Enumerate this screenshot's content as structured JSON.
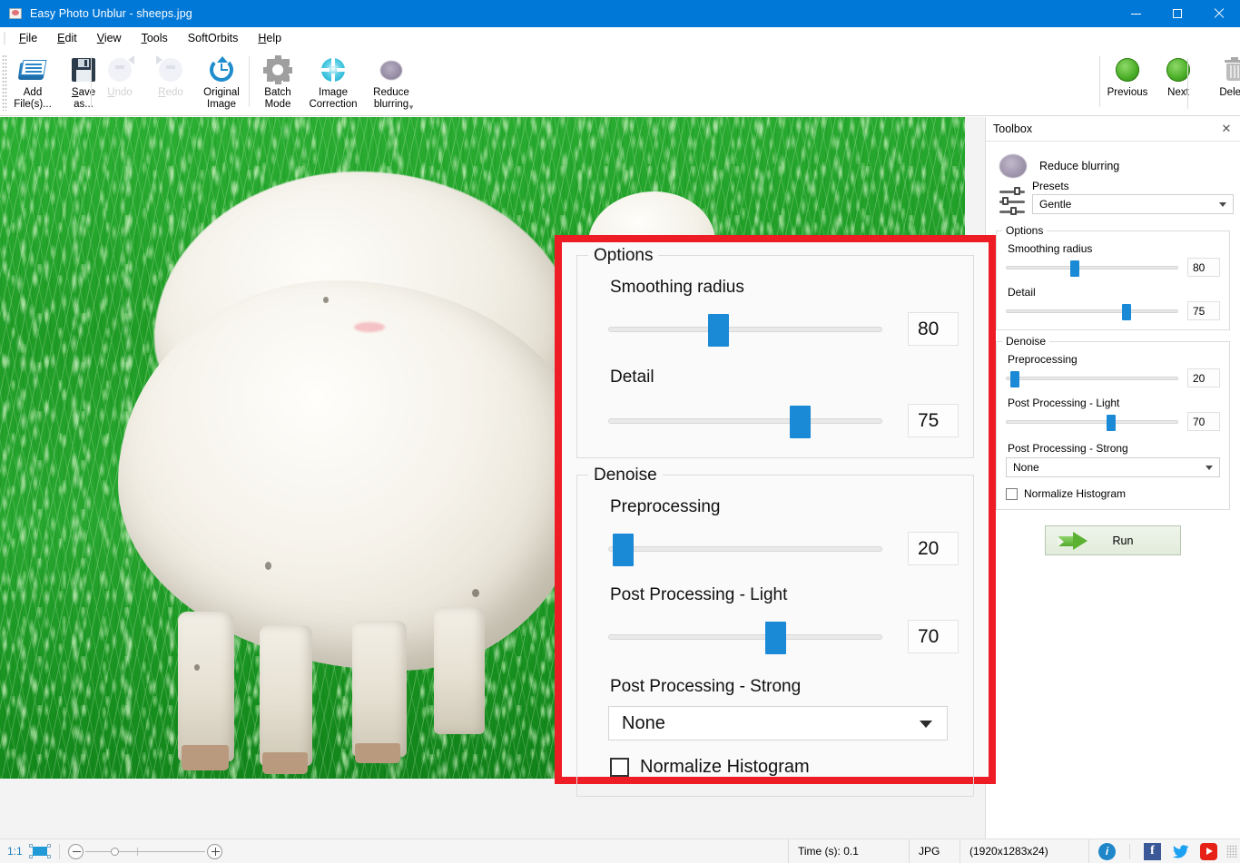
{
  "window": {
    "title": "Easy Photo Unblur - sheeps.jpg",
    "icon": "app-photo-icon",
    "controls": {
      "minimize": "–",
      "maximize": "□",
      "close": "✕"
    }
  },
  "menu": {
    "items": [
      {
        "label": "File",
        "accel": "F"
      },
      {
        "label": "Edit",
        "accel": "E"
      },
      {
        "label": "View",
        "accel": "V"
      },
      {
        "label": "Tools",
        "accel": "T"
      },
      {
        "label": "SoftOrbits",
        "accel": ""
      },
      {
        "label": "Help",
        "accel": "H"
      }
    ]
  },
  "toolbar": {
    "left_buttons": [
      {
        "label_line1": "Add",
        "label_line2": "File(s)...",
        "icon": "add-files-icon",
        "enabled": true
      },
      {
        "label_line1": "Save",
        "label_line2": "as...",
        "icon": "save-as-icon",
        "enabled": true
      },
      {
        "label_line1": "Undo",
        "label_line2": "",
        "icon": "undo-icon",
        "enabled": false
      },
      {
        "label_line1": "Redo",
        "label_line2": "",
        "icon": "redo-icon",
        "enabled": false
      },
      {
        "label_line1": "Original",
        "label_line2": "Image",
        "icon": "original-image-icon",
        "enabled": true
      },
      {
        "label_line1": "Batch",
        "label_line2": "Mode",
        "icon": "batch-mode-icon",
        "enabled": true
      },
      {
        "label_line1": "Image",
        "label_line2": "Correction",
        "icon": "image-correction-icon",
        "enabled": true
      },
      {
        "label_line1": "Reduce",
        "label_line2": "blurring",
        "icon": "reduce-blurring-icon",
        "enabled": true
      }
    ],
    "right_buttons": [
      {
        "label_line1": "Previous",
        "label_line2": "",
        "icon": "previous-icon",
        "enabled": true
      },
      {
        "label_line1": "Next",
        "label_line2": "",
        "icon": "next-icon",
        "enabled": true
      },
      {
        "label_line1": "Delete",
        "label_line2": "",
        "icon": "delete-icon",
        "enabled": true
      }
    ],
    "overflow_glyph": "▾"
  },
  "toolbox": {
    "header": "Toolbox",
    "close_glyph": "✕",
    "tool_name": "Reduce blurring",
    "presets_label": "Presets",
    "presets_value": "Gentle",
    "options_group": {
      "legend": "Options",
      "fields": [
        {
          "label": "Smoothing radius",
          "value": "80",
          "percent": 40
        },
        {
          "label": "Detail",
          "value": "75",
          "percent": 70
        }
      ]
    },
    "denoise_group": {
      "legend": "Denoise",
      "fields": [
        {
          "label": "Preprocessing",
          "value": "20",
          "percent": 5
        },
        {
          "label": "Post Processing - Light",
          "value": "70",
          "percent": 61
        }
      ],
      "strong_label": "Post Processing - Strong",
      "strong_value": "None",
      "checkbox_label": "Normalize Histogram",
      "checkbox_checked": false
    },
    "run_label": "Run"
  },
  "overlay": {
    "border_color": "#ee1c25",
    "options_group": {
      "legend": "Options",
      "fields": [
        {
          "label": "Smoothing radius",
          "value": "80",
          "percent": 40
        },
        {
          "label": "Detail",
          "value": "75",
          "percent": 70
        }
      ]
    },
    "denoise_group": {
      "legend": "Denoise",
      "fields": [
        {
          "label": "Preprocessing",
          "value": "20",
          "percent": 5
        },
        {
          "label": "Post Processing - Light",
          "value": "70",
          "percent": 61
        }
      ],
      "strong_label": "Post Processing - Strong",
      "strong_value": "None",
      "checkbox_label": "Normalize Histogram",
      "checkbox_checked": false
    }
  },
  "statusbar": {
    "zoom_ratio": "1:1",
    "fit_icon": "fit-to-window-icon",
    "zoom_out_glyph": "−",
    "zoom_in_glyph": "+",
    "time_label": "Time (s): 0.1",
    "format": "JPG",
    "dimensions": "(1920x1283x24)",
    "icons": [
      {
        "name": "info-icon",
        "glyph": "i"
      },
      {
        "name": "facebook-icon",
        "glyph": "f"
      },
      {
        "name": "twitter-icon",
        "glyph": ""
      },
      {
        "name": "youtube-icon",
        "glyph": ""
      }
    ]
  },
  "colors": {
    "titlebar": "#0078d7",
    "accent_blue": "#1b8ad6",
    "overlay_red": "#ee1c25",
    "run_green": "#5bb132"
  }
}
